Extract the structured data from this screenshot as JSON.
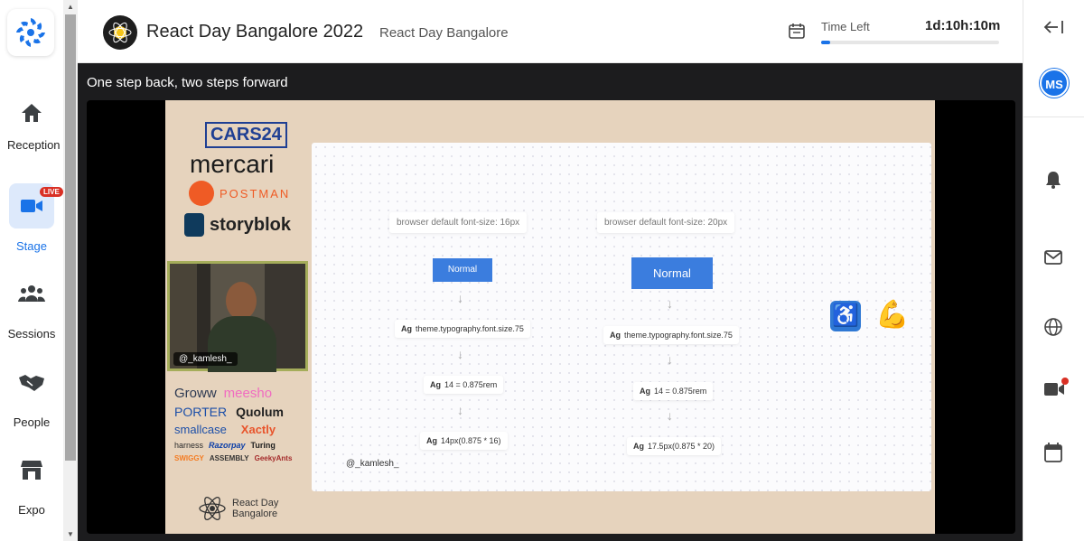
{
  "event": {
    "title": "React Day Bangalore 2022",
    "subtitle": "React Day Bangalore",
    "time_left_label": "Time Left",
    "time_left_value": "1d:10h:10m",
    "time_progress_fraction": 0.05
  },
  "nav": {
    "items": [
      {
        "label": "Reception",
        "icon": "home-icon"
      },
      {
        "label": "Stage",
        "icon": "video-camera-icon",
        "badge": "LIVE",
        "active": true
      },
      {
        "label": "Sessions",
        "icon": "people-group-icon"
      },
      {
        "label": "People",
        "icon": "handshake-icon"
      },
      {
        "label": "Expo",
        "icon": "store-icon"
      }
    ]
  },
  "stage": {
    "session_title": "One step back, two steps forward"
  },
  "slide": {
    "sponsors_top": [
      "CARS24",
      "mercari",
      "POSTMAN",
      "storyblok"
    ],
    "cam_handle": "@_kamlesh_",
    "sponsors_bottom": [
      [
        "Groww",
        "meesho"
      ],
      [
        "PORTER",
        "Quolum"
      ],
      [
        "smallcase",
        "Xactly"
      ],
      [
        "harness",
        "Razorpay",
        "Turing"
      ],
      [
        "SWIGGY",
        "ASSEMBLY",
        "GeekyAnts"
      ]
    ],
    "footer_line1": "React Day",
    "footer_line2": "Bangalore",
    "card": {
      "left_label": "browser default font-size: 16px",
      "right_label": "browser default font-size: 20px",
      "normal": "Normal",
      "ag": "Ag",
      "left_steps": [
        "theme.typography.font.size.75",
        "14 = 0.875rem",
        "14px(0.875 * 16)"
      ],
      "right_steps": [
        "theme.typography.font.size.75",
        "14 = 0.875rem",
        "17.5px(0.875 * 20)"
      ],
      "handle": "@_kamlesh_"
    }
  },
  "user": {
    "initials": "MS"
  },
  "colors": {
    "accent": "#1a73e8",
    "live": "#d93025",
    "stage_bg": "#1c1c1e",
    "slide_bg": "#e6d3bd"
  }
}
